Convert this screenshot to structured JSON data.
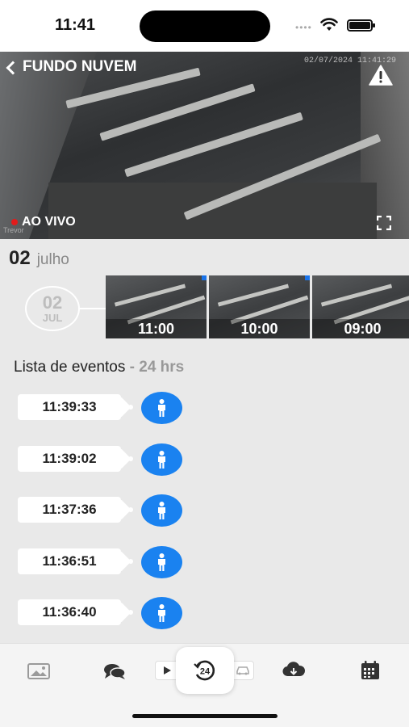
{
  "status_bar": {
    "time": "11:41"
  },
  "camera": {
    "title": "FUNDO NUVEM",
    "timestamp": "02/07/2024 11:41:29",
    "live_label": "AO VIVO",
    "brand": "Trevor"
  },
  "date_header": {
    "day": "02",
    "month": "julho"
  },
  "timeline": {
    "date_day": "02",
    "date_month": "JUL",
    "thumbnails": [
      {
        "label": "11:00"
      },
      {
        "label": "10:00"
      },
      {
        "label": "09:00"
      }
    ]
  },
  "events": {
    "title": "Lista de eventos",
    "range": "- 24 hrs",
    "items": [
      {
        "time": "11:39:33",
        "type": "person-icon"
      },
      {
        "time": "11:39:02",
        "type": "person-icon"
      },
      {
        "time": "11:37:36",
        "type": "person-icon"
      },
      {
        "time": "11:36:51",
        "type": "person-icon"
      },
      {
        "time": "11:36:40",
        "type": "person-icon"
      }
    ]
  },
  "tab_bar": {
    "tabs": [
      "image-icon",
      "chat-icon",
      "play-icon",
      "24h-icon",
      "car-icon",
      "cloud-download-icon",
      "calendar-icon"
    ]
  },
  "colors": {
    "accent": "#1a82f0",
    "live": "#e21b1b"
  }
}
